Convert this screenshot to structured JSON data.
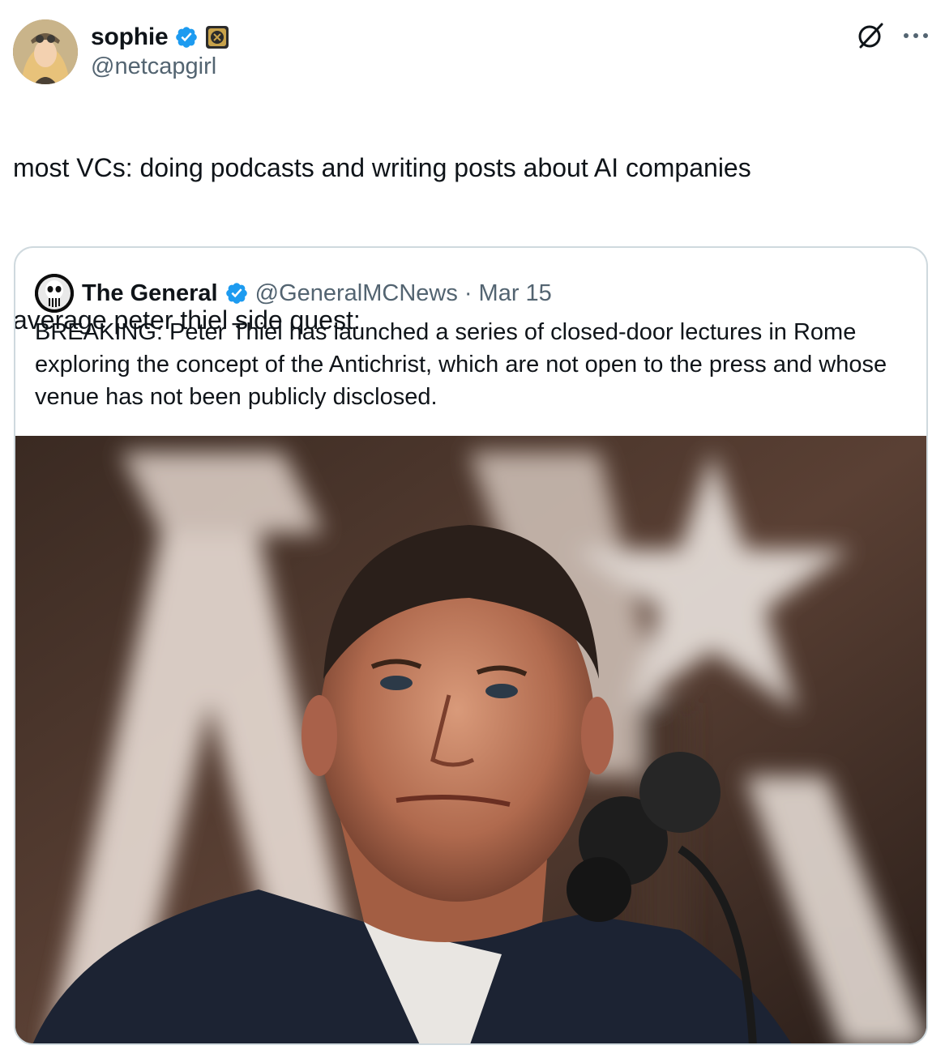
{
  "post": {
    "author": {
      "display_name": "sophie",
      "handle": "@netcapgirl"
    },
    "text_line_1": "most VCs: doing podcasts and writing posts about AI companies",
    "text_line_2": "average peter thiel side quest:",
    "icons": {
      "grok": "grok-icon",
      "more": "more-icon",
      "verified": "verified-badge-icon",
      "affiliate": "affiliate-badge-icon"
    }
  },
  "quoted_post": {
    "author": {
      "display_name": "The General",
      "handle": "@GeneralMCNews"
    },
    "separator": "·",
    "date": "Mar 15",
    "text": "BREAKING: Peter Thiel has launched a series of closed-door lectures in Rome exploring the concept of the Antichrist, which are not open to the press and whose venue has not been publicly disclosed."
  },
  "colors": {
    "text_primary": "#0f1419",
    "text_secondary": "#536471",
    "verified_blue": "#1d9bf0",
    "border": "#cfd9de"
  }
}
